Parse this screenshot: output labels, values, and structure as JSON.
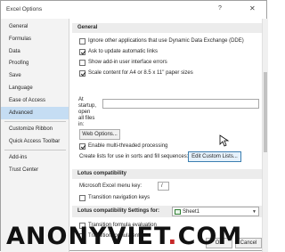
{
  "window": {
    "title": "Excel Options",
    "help_glyph": "?",
    "close_glyph": "✕"
  },
  "sidebar": {
    "items": [
      {
        "label": "General"
      },
      {
        "label": "Formulas"
      },
      {
        "label": "Data"
      },
      {
        "label": "Proofing"
      },
      {
        "label": "Save"
      },
      {
        "label": "Language"
      },
      {
        "label": "Ease of Access"
      },
      {
        "label": "Advanced",
        "selected": true
      },
      {
        "label": "Customize Ribbon"
      },
      {
        "label": "Quick Access Toolbar"
      },
      {
        "label": "Add-ins"
      },
      {
        "label": "Trust Center"
      }
    ]
  },
  "general": {
    "header": "General",
    "ignore_dde": "Ignore other applications that use Dynamic Data Exchange (DDE)",
    "ask_update_links": "Ask to update automatic links",
    "show_addin_errors": "Show add-in user interface errors",
    "scale_content": "Scale content for A4 or 8.5 x 11\" paper sizes",
    "startup_label_1": "At",
    "startup_label_2": "startup,",
    "startup_label_3": "open",
    "startup_label_4": "all files",
    "startup_label_5": "in:",
    "startup_value": "",
    "web_options_button": "Web Options...",
    "multithreaded": "Enable multi-threaded processing",
    "custom_lists_label": "Create lists for use in sorts and fill sequences:",
    "edit_custom_lists_button": "Edit Custom Lists..."
  },
  "lotus": {
    "header": "Lotus compatibility",
    "menu_key_label": "Microsoft Excel menu key:",
    "menu_key_value": "/",
    "transition_nav_keys": "Transition navigation keys"
  },
  "lotus_settings": {
    "header": "Lotus compatibility Settings for:",
    "sheet_value": "Sheet1",
    "transition_formula_eval": "Transition formula evaluation",
    "transition_formula_entry": "Transition formula entry"
  },
  "footer": {
    "ok_button": "OK",
    "cancel_button": "Cancel"
  },
  "watermark": {
    "text_a": "ANONYVIET",
    "dot": ".",
    "text_b": "COM"
  },
  "colors": {
    "selected_nav": "#c5ddf3",
    "section_bg": "#ececec",
    "accent": "#3c7fb1"
  }
}
